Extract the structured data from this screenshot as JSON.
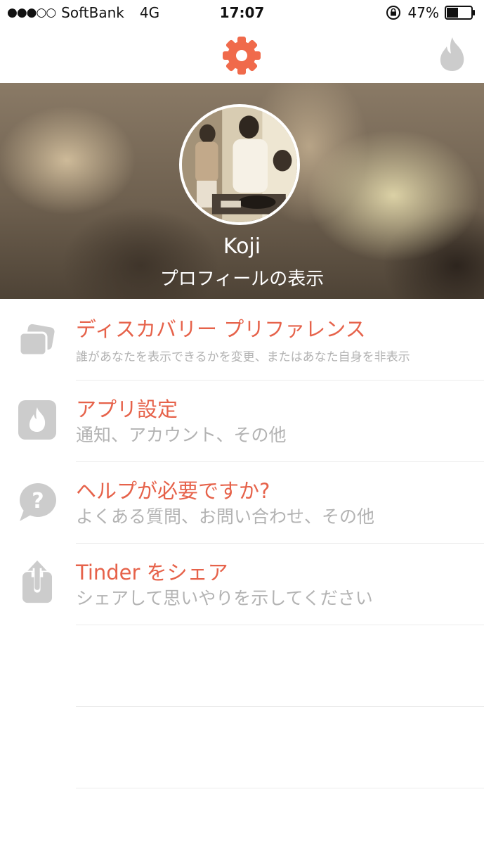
{
  "status_bar": {
    "signal": "●●●○○",
    "carrier": "SoftBank",
    "network": "4G",
    "time": "17:07",
    "battery_percent": "47%",
    "battery_level": 0.47
  },
  "nav": {
    "settings_icon": "gear-icon",
    "matches_icon": "flame-icon",
    "accent_color": "#f06a4b"
  },
  "profile": {
    "name": "Koji",
    "view_profile": "プロフィールの表示"
  },
  "menu": [
    {
      "icon": "cards-icon",
      "title": "ディスカバリー プリファレンス",
      "subtitle": "誰があなたを表示できるかを変更、またはあなた自身を非表示"
    },
    {
      "icon": "flame-icon",
      "title": "アプリ設定",
      "subtitle": "通知、アカウント、その他"
    },
    {
      "icon": "help-bubble-icon",
      "title": "ヘルプが必要ですか?",
      "subtitle": "よくある質問、お問い合わせ、その他"
    },
    {
      "icon": "share-icon",
      "title": "Tinder をシェア",
      "subtitle": "シェアして思いやりを示してください"
    }
  ],
  "colors": {
    "title": "#e6624a",
    "subtitle": "#b3b3b3",
    "icon_gray": "#cccccc"
  }
}
